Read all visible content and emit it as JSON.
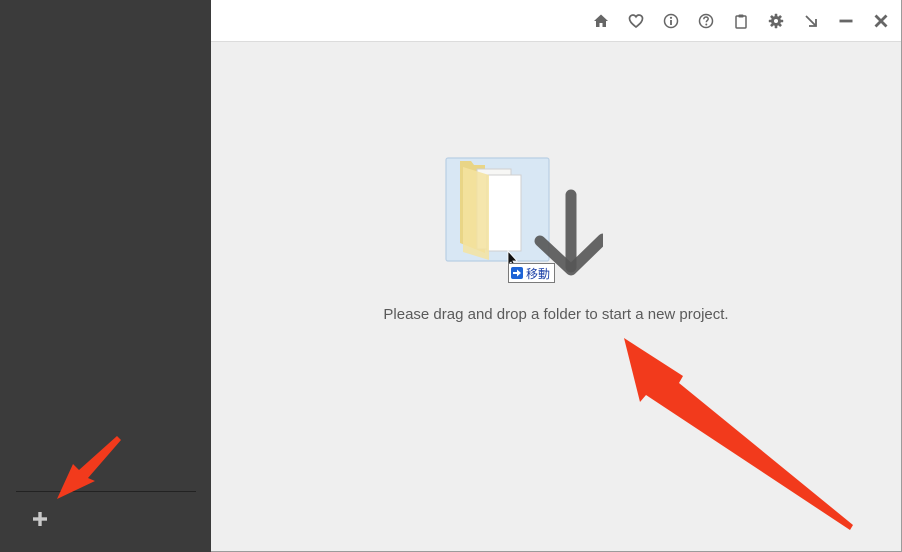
{
  "toolbar": {
    "buttons": [
      {
        "name": "home-icon",
        "label": "Home"
      },
      {
        "name": "heart-icon",
        "label": "Favorites"
      },
      {
        "name": "info-icon",
        "label": "Info"
      },
      {
        "name": "help-icon",
        "label": "Help"
      },
      {
        "name": "clipboard-icon",
        "label": "Clipboard"
      },
      {
        "name": "gear-icon",
        "label": "Settings"
      },
      {
        "name": "collapse-arrow-icon",
        "label": "Collapse"
      },
      {
        "name": "minimize-icon",
        "label": "Minimize"
      },
      {
        "name": "close-icon",
        "label": "Close"
      }
    ]
  },
  "main": {
    "drop_message": "Please drag and drop a folder to start a new project.",
    "drag_tooltip": "移動"
  },
  "sidebar": {
    "add_button_icon": "plus-icon"
  },
  "colors": {
    "sidebar_bg": "#3b3b3b",
    "main_bg": "#efefef",
    "toolbar_bg": "#ffffff",
    "icon_gray": "#6b6b6b",
    "annotation_red": "#f23a1c"
  }
}
